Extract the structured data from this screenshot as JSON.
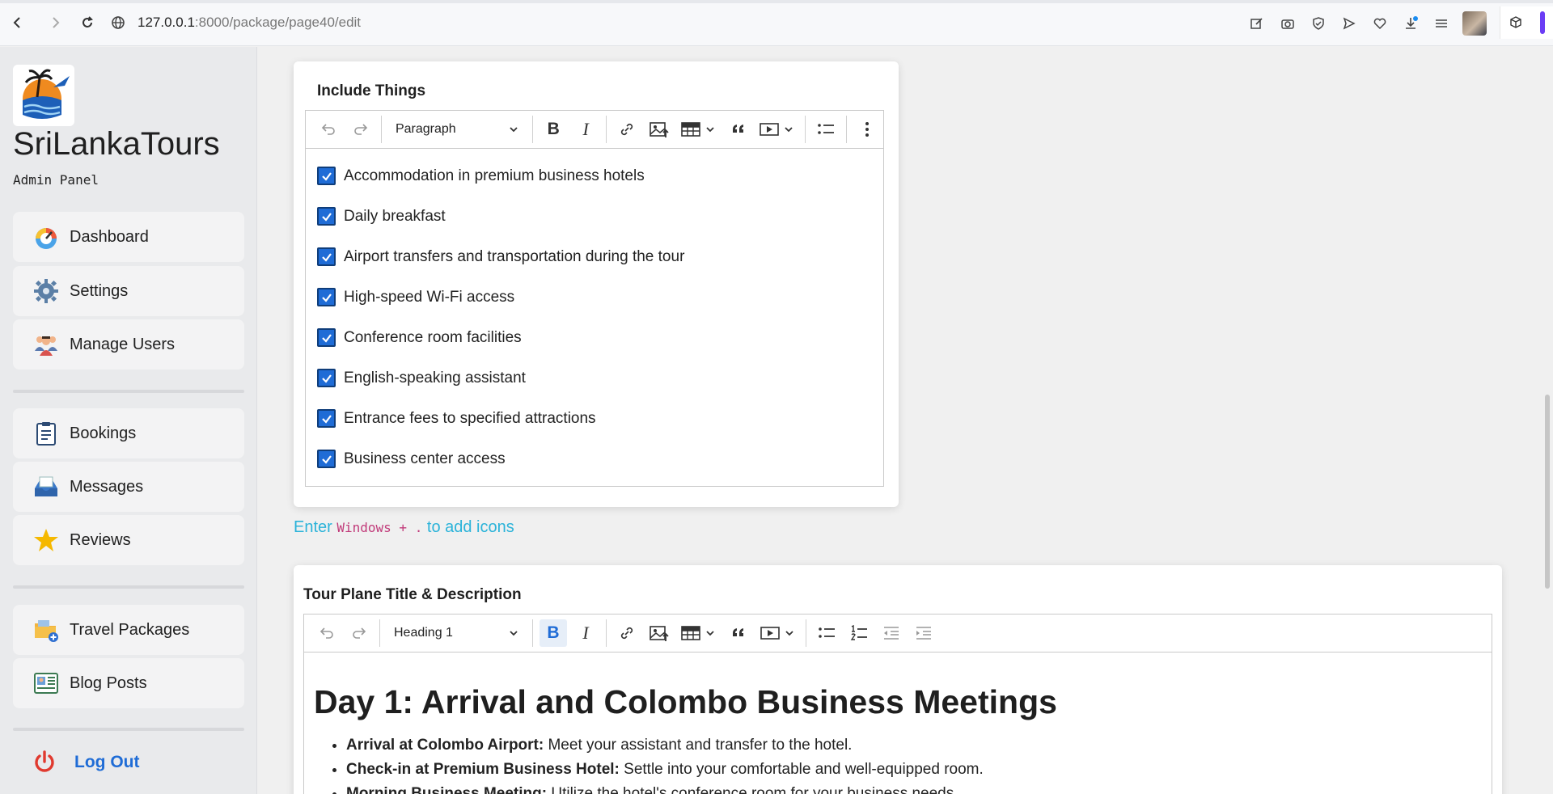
{
  "browser": {
    "url_host": "127.0.0.1",
    "url_rest": ":8000/package/page40/edit"
  },
  "sidebar": {
    "brand": "SriLankaTours",
    "subtitle": "Admin Panel",
    "groups": [
      [
        {
          "label": "Dashboard",
          "icon": "speedometer-icon"
        },
        {
          "label": "Settings",
          "icon": "gear-icon"
        },
        {
          "label": "Manage Users",
          "icon": "users-icon"
        }
      ],
      [
        {
          "label": "Bookings",
          "icon": "clipboard-icon"
        },
        {
          "label": "Messages",
          "icon": "inbox-icon"
        },
        {
          "label": "Reviews",
          "icon": "star-icon"
        }
      ],
      [
        {
          "label": "Travel Packages",
          "icon": "folder-add-icon"
        },
        {
          "label": "Blog Posts",
          "icon": "newspaper-icon"
        }
      ]
    ],
    "logout": "Log Out"
  },
  "include_card": {
    "title": "Include Things",
    "paragraph_style": "Paragraph",
    "items": [
      "Accommodation in premium business hotels",
      "Daily breakfast",
      "Airport transfers and transportation during the tour",
      "High-speed Wi-Fi access",
      "Conference room facilities",
      "English-speaking assistant",
      "Entrance fees to specified attractions",
      "Business center access"
    ]
  },
  "hint": {
    "before": "Enter ",
    "code": "Windows + .",
    "after": " to add icons"
  },
  "tour_card": {
    "title": "Tour Plane Title & Description",
    "paragraph_style": "Heading 1",
    "heading": "Day 1: Arrival and Colombo Business Meetings",
    "bullets": [
      {
        "bold": "Arrival at Colombo Airport:",
        "text": " Meet your assistant and transfer to the hotel."
      },
      {
        "bold": "Check-in at Premium Business Hotel:",
        "text": " Settle into your comfortable and well-equipped room."
      },
      {
        "bold": "Morning Business Meeting:",
        "text": " Utilize the hotel's conference room for your business needs."
      }
    ]
  }
}
